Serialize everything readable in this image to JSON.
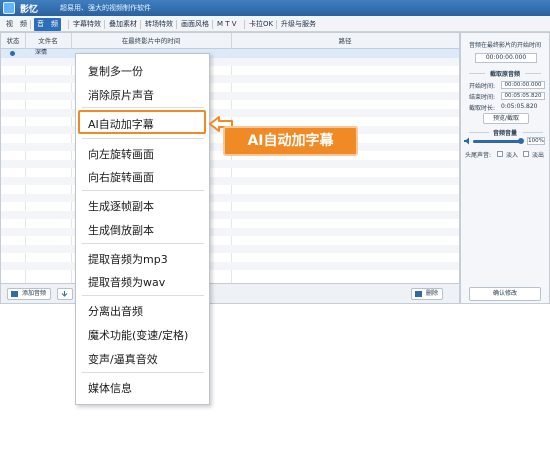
{
  "titlebar": {
    "app_name": "影忆",
    "slogan": "超易用、强大的视频制作软件",
    "logo_text": "YE"
  },
  "menu": {
    "items": [
      "视　频",
      "音　频",
      "字幕特效",
      "叠加素材",
      "转场特效",
      "画面风格",
      "M T V",
      "卡拉OK",
      "升级与服务"
    ],
    "active_index": 1
  },
  "table": {
    "headers": [
      "状态",
      "文件名",
      "在最终影片中的时间",
      "路径"
    ],
    "first_row": {
      "name": "深情"
    }
  },
  "bottom": {
    "add_audio": "添加音频",
    "delete": "删除"
  },
  "right_panel": {
    "position_title": "音频在最终影片的开始时间",
    "start_display": "00:00:00.000",
    "clip_section": "截取原音频",
    "start_label": "开始时间:",
    "start_value": "00:00:00.000",
    "end_label": "结束时间:",
    "end_value": "00:05:05.820",
    "length_label": "截取时长:",
    "length_value": "0:05:05.820",
    "preview_button": "预览/截取",
    "volume_section": "音频音量",
    "volume_value": "100%",
    "volume_fraction": 1.0,
    "head_tail_label": "头尾声音:",
    "fade_in": "淡入",
    "fade_out": "淡出",
    "confirm_button": "确认修改"
  },
  "context_menu": {
    "items": [
      "复制多一份",
      "消除原片声音",
      "AI自动加字幕",
      "向左旋转画面",
      "向右旋转画面",
      "生成逐帧副本",
      "生成倒放副本",
      "提取音频为mp3",
      "提取音频为wav",
      "分离出音频",
      "魔术功能(变速/定格)",
      "变声/逼真音效",
      "媒体信息"
    ]
  },
  "callout": {
    "text": "AI自动加字幕"
  },
  "colors": {
    "accent": "#f08a24",
    "brand": "#2f6aa8"
  }
}
